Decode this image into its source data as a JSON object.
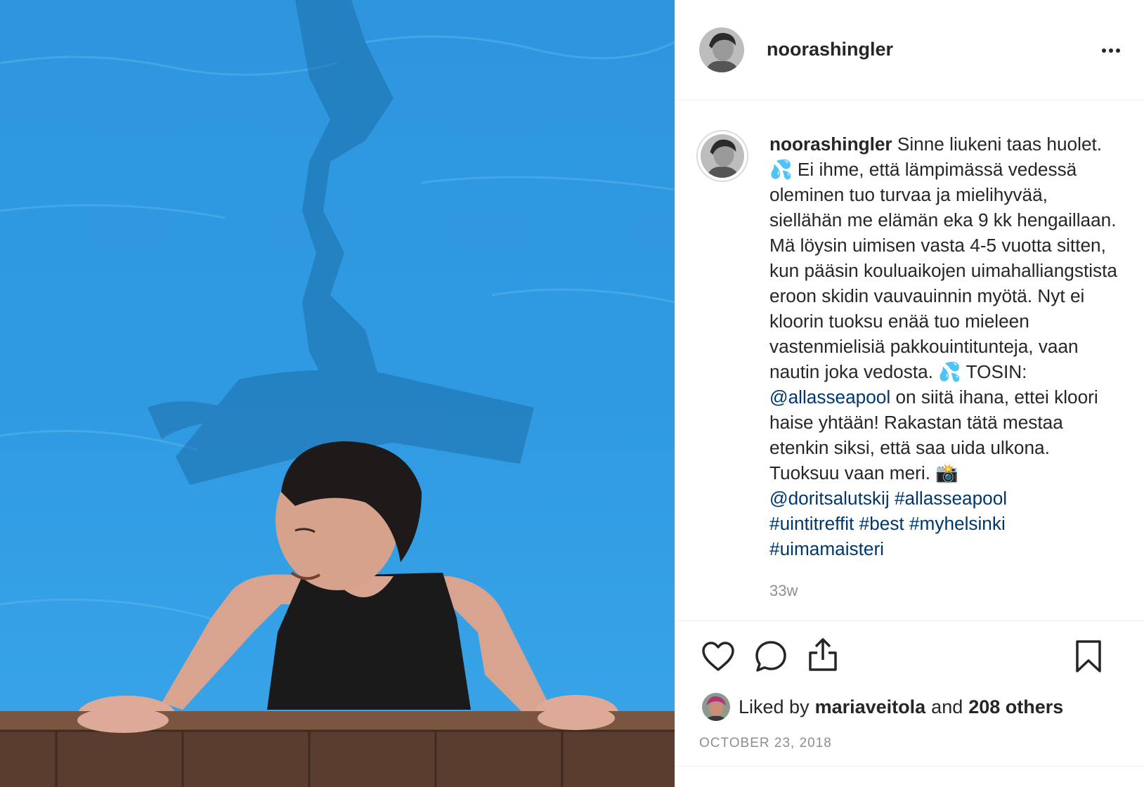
{
  "photo": {
    "alt": ""
  },
  "header": {
    "username": "noorashingler",
    "more_label": "More options"
  },
  "caption": {
    "username": "noorashingler",
    "parts": {
      "p1": " Sinne liukeni taas huolet. 💦 Ei ihme, että lämpimässä vedessä oleminen tuo turvaa ja mielihyvää, siellähän me elämän eka 9 kk hengaillaan. Mä löysin uimisen vasta 4-5 vuotta sitten, kun pääsin kouluaikojen uimahalliangstista eroon skidin vauvauinnin myötä. Nyt ei kloorin tuoksu enää tuo mieleen vastenmielisiä pakkouintitunteja, vaan nautin joka vedosta. 💦 TOSIN: ",
      "mention1": "@allasseapool",
      "p2": " on siitä ihana, ettei kloori haise yhtään! Rakastan tätä mestaa etenkin siksi, että saa uida ulkona. Tuoksuu vaan meri. 📸 ",
      "mention2": "@doritsalutskij",
      "tag1": "#allasseapool",
      "tag2": "#uintitreffit",
      "tag3": "#best",
      "tag4": "#myhelsinki",
      "tag5": "#uimamaisteri"
    },
    "timestamp": "33w"
  },
  "actions": {
    "like_icon": "heart-icon",
    "comment_icon": "comment-icon",
    "share_icon": "share-icon",
    "save_icon": "bookmark-icon"
  },
  "likes": {
    "prefix": "Liked by",
    "user": "mariaveitola",
    "and": "and",
    "others": "208 others"
  },
  "date": "OCTOBER 23, 2018",
  "colors": {
    "link": "#00376b",
    "muted": "#8e8e8e",
    "text": "#262626",
    "border": "#efefef",
    "water": "#2c98e0"
  }
}
